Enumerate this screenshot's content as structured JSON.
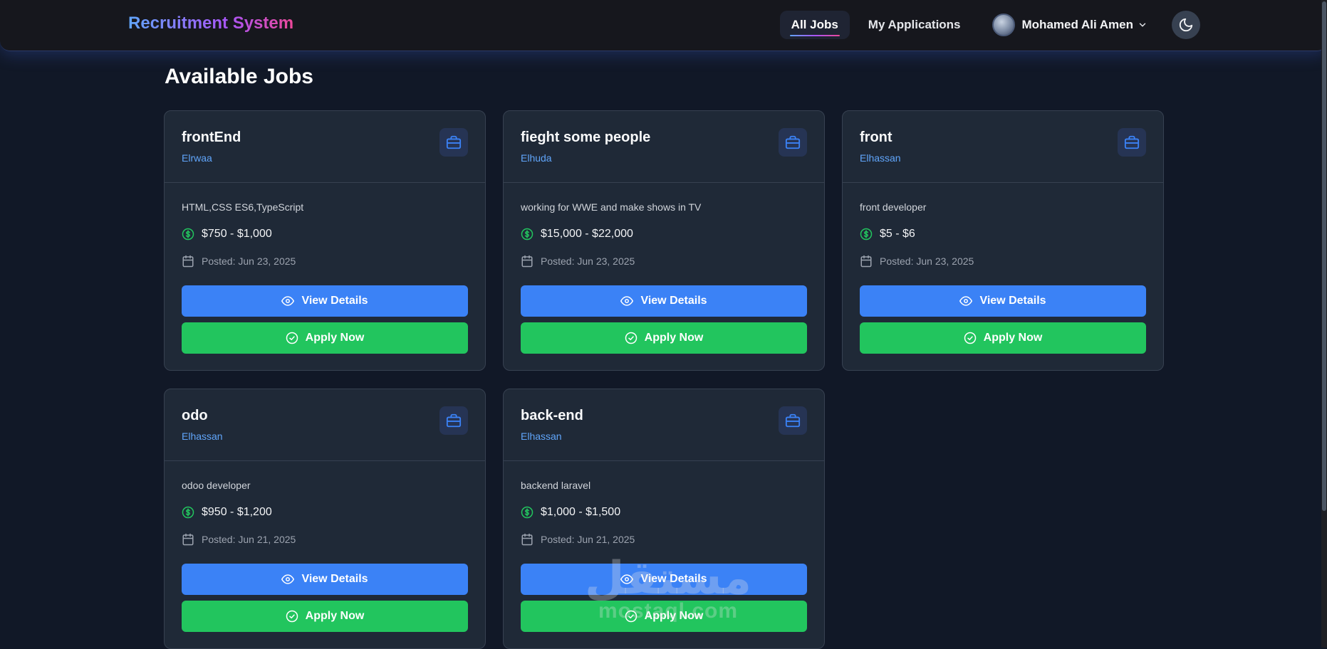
{
  "brand": "Recruitment System",
  "nav": {
    "all_jobs": "All Jobs",
    "my_applications": "My Applications",
    "user_name": "Mohamed Ali Amen"
  },
  "page_title": "Available Jobs",
  "buttons": {
    "view": "View Details",
    "apply": "Apply Now"
  },
  "jobs": [
    {
      "title": "frontEnd",
      "company": "Elrwaa",
      "description": "HTML,CSS ES6,TypeScript",
      "salary": "$750 - $1,000",
      "posted": "Posted: Jun 23, 2025"
    },
    {
      "title": "fieght some people",
      "company": "Elhuda",
      "description": "working for WWE and make shows in TV",
      "salary": "$15,000 - $22,000",
      "posted": "Posted: Jun 23, 2025"
    },
    {
      "title": "front",
      "company": "Elhassan",
      "description": "front developer",
      "salary": "$5 - $6",
      "posted": "Posted: Jun 23, 2025"
    },
    {
      "title": "odo",
      "company": "Elhassan",
      "description": "odoo developer",
      "salary": "$950 - $1,200",
      "posted": "Posted: Jun 21, 2025"
    },
    {
      "title": "back-end",
      "company": "Elhassan",
      "description": "backend laravel",
      "salary": "$1,000 - $1,500",
      "posted": "Posted: Jun 21, 2025"
    }
  ],
  "watermark": {
    "arabic": "مستقل",
    "latin": "mostaql.com"
  },
  "colors": {
    "background": "#111827",
    "card": "#1f2937",
    "primary": "#3b82f6",
    "success": "#22c55e",
    "link": "#60a5fa"
  }
}
